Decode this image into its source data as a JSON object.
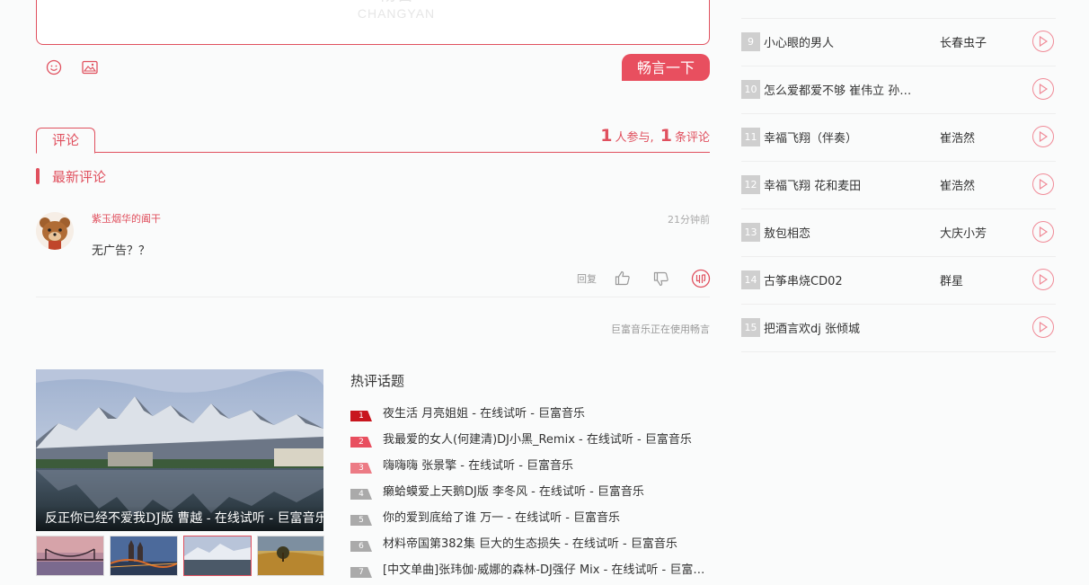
{
  "colors": {
    "accent": "#e0505e",
    "button": "#e84f5f",
    "rank1": "#c8161e",
    "rank2": "#e84f5f",
    "rank3": "#ec7b85",
    "rankN": "#aaaaaa"
  },
  "comment_box": {
    "logo_cn": "畅言",
    "logo_en": "CHANGYAN",
    "submit_label": "畅言一下",
    "icons": [
      "smiley-icon",
      "image-icon"
    ]
  },
  "tabs": {
    "comment": "评论"
  },
  "stats": {
    "participants": "1",
    "participants_label": "人参与,",
    "comments": "1",
    "comments_label": "条评论"
  },
  "latest": {
    "title": "最新评论"
  },
  "comments": [
    {
      "user": "紫玉烟华的阖干",
      "time": "21分钟前",
      "text": "无广告？？",
      "reply": "回复"
    }
  ],
  "powered_by": "巨富音乐正在使用畅言",
  "slider": {
    "caption": "反正你已经不爱我DJ版 曹越 - 在线试听 - 巨富音乐"
  },
  "hot": {
    "title": "热评话题",
    "items": [
      {
        "rank": "1",
        "text": "夜生活 月亮姐姐 - 在线试听 - 巨富音乐"
      },
      {
        "rank": "2",
        "text": "我最爱的女人(何建清)DJ小黑_Remix - 在线试听 - 巨富音乐"
      },
      {
        "rank": "3",
        "text": "嗨嗨嗨 张景擎 - 在线试听 - 巨富音乐"
      },
      {
        "rank": "4",
        "text": "癞蛤蟆爱上天鹅DJ版 李冬风 - 在线试听 - 巨富音乐"
      },
      {
        "rank": "5",
        "text": "你的爱到底给了谁 万一 - 在线试听 - 巨富音乐"
      },
      {
        "rank": "6",
        "text": "材料帝国第382集 巨大的生态损失 - 在线试听 - 巨富音乐"
      },
      {
        "rank": "7",
        "text": "[中文单曲]张玮伽·威娜的森林-DJ强仔 Mix - 在线试听 - 巨富音乐"
      }
    ]
  },
  "playlist": [
    {
      "num": "9",
      "title": "小心眼的男人",
      "artist": "长春虫子"
    },
    {
      "num": "10",
      "title": "怎么爱都爱不够 崔伟立 孙…",
      "artist": ""
    },
    {
      "num": "11",
      "title": "幸福飞翔（伴奏）",
      "artist": "崔浩然"
    },
    {
      "num": "12",
      "title": "幸福飞翔 花和麦田",
      "artist": "崔浩然"
    },
    {
      "num": "13",
      "title": "敖包相恋",
      "artist": "大庆小芳"
    },
    {
      "num": "14",
      "title": "古筝串烧CD02",
      "artist": "群星"
    },
    {
      "num": "15",
      "title": "把酒言欢dj 张倾城",
      "artist": ""
    }
  ]
}
